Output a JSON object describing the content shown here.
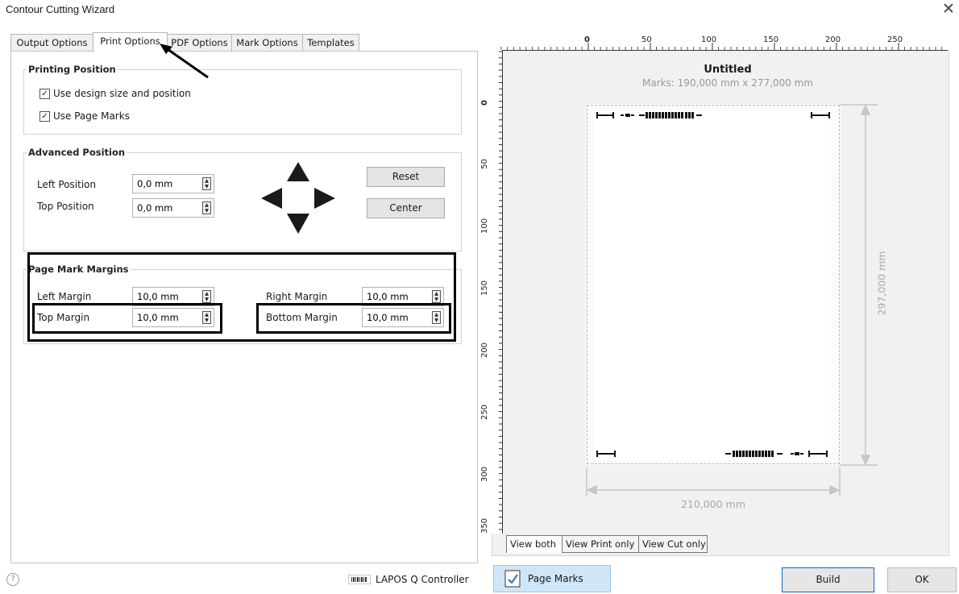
{
  "window": {
    "title": "Contour Cutting Wizard"
  },
  "tabs": [
    {
      "label": "Output Options"
    },
    {
      "label": "Print Options"
    },
    {
      "label": "PDF Options"
    },
    {
      "label": "Mark Options"
    },
    {
      "label": "Templates"
    }
  ],
  "printing_position": {
    "legend": "Printing Position",
    "use_design_size": "Use design size and position",
    "use_page_marks": "Use Page Marks"
  },
  "advanced_position": {
    "legend": "Advanced Position",
    "left_label": "Left Position",
    "left_value": "0,0 mm",
    "top_label": "Top Position",
    "top_value": "0,0 mm",
    "reset": "Reset",
    "center": "Center"
  },
  "page_mark_margins": {
    "legend": "Page Mark Margins",
    "left_label": "Left Margin",
    "left_value": "10,0 mm",
    "right_label": "Right Margin",
    "right_value": "10,0 mm",
    "top_label": "Top Margin",
    "top_value": "10,0 mm",
    "bottom_label": "Bottom Margin",
    "bottom_value": "10,0 mm"
  },
  "preview": {
    "doc_title": "Untitled",
    "marks_info": "Marks: 190,000 mm x 277,000 mm",
    "height_dim": "297,000 mm",
    "width_dim": "210,000 mm",
    "ruler_top": [
      "0",
      "50",
      "100",
      "150",
      "200",
      "250"
    ],
    "ruler_left": [
      "0",
      "50",
      "100",
      "150",
      "200",
      "250",
      "300",
      "350"
    ],
    "view_tabs": [
      {
        "label": "View both"
      },
      {
        "label": "View Print only"
      },
      {
        "label": "View Cut only"
      }
    ]
  },
  "footer": {
    "controller": "LAPOS Q Controller",
    "page_marks": "Page Marks",
    "build": "Build",
    "ok": "OK",
    "help": "?"
  },
  "icons": {
    "close": "close-icon",
    "help": "help-icon",
    "barcode": "barcode-icon",
    "page_marks": "page-marks-icon"
  }
}
